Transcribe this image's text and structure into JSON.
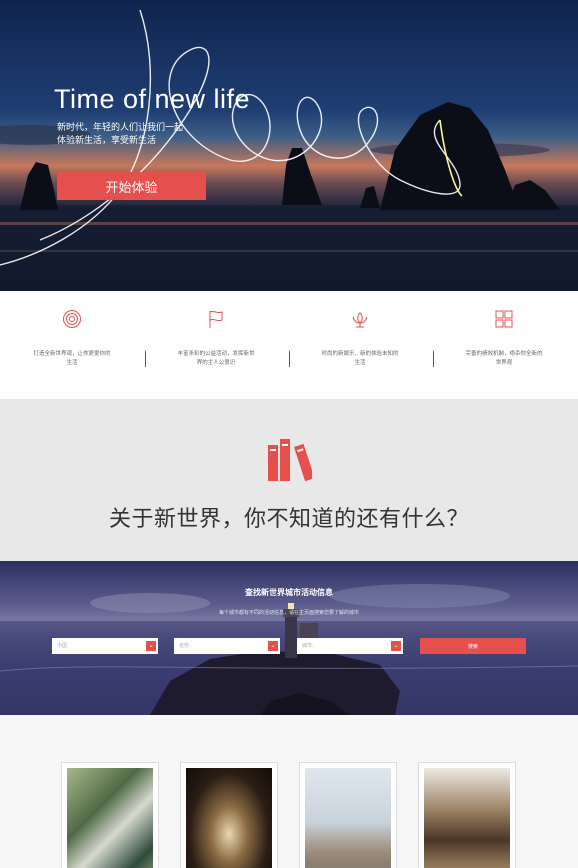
{
  "hero": {
    "title": "Time of new life",
    "subtitle_line1": "新时代，年轻的人们让我们一起",
    "subtitle_line2": "体验新生活，享受新生活",
    "cta_label": "开始体验"
  },
  "features": [
    {
      "icon": "target-icon",
      "text": "打造全新世界观，让你更爱你的生活"
    },
    {
      "icon": "flag-icon",
      "text": "丰富多彩的公益活动，发挥新世界的主人公意识"
    },
    {
      "icon": "lotus-icon",
      "text": "时尚的新娱乐，新的体验未知的生活"
    },
    {
      "icon": "grid-icon",
      "text": "完善的绩效机制，绝杀你全新的世界观"
    }
  ],
  "about": {
    "title": "关于新世界，你不知道的还有什么？",
    "icon": "books-icon"
  },
  "search": {
    "title": "查找新世界城市活动信息",
    "subtitle": "每个城市都有不同的活动信息，请在主页面搜索您要了解的城市",
    "country_placeholder": "中国",
    "province_placeholder": "省份：",
    "city_placeholder": "城市：",
    "button_label": "搜索"
  },
  "colors": {
    "accent": "#e5504c",
    "about_bg": "#e8e8e8",
    "feature_text": "#666666"
  }
}
